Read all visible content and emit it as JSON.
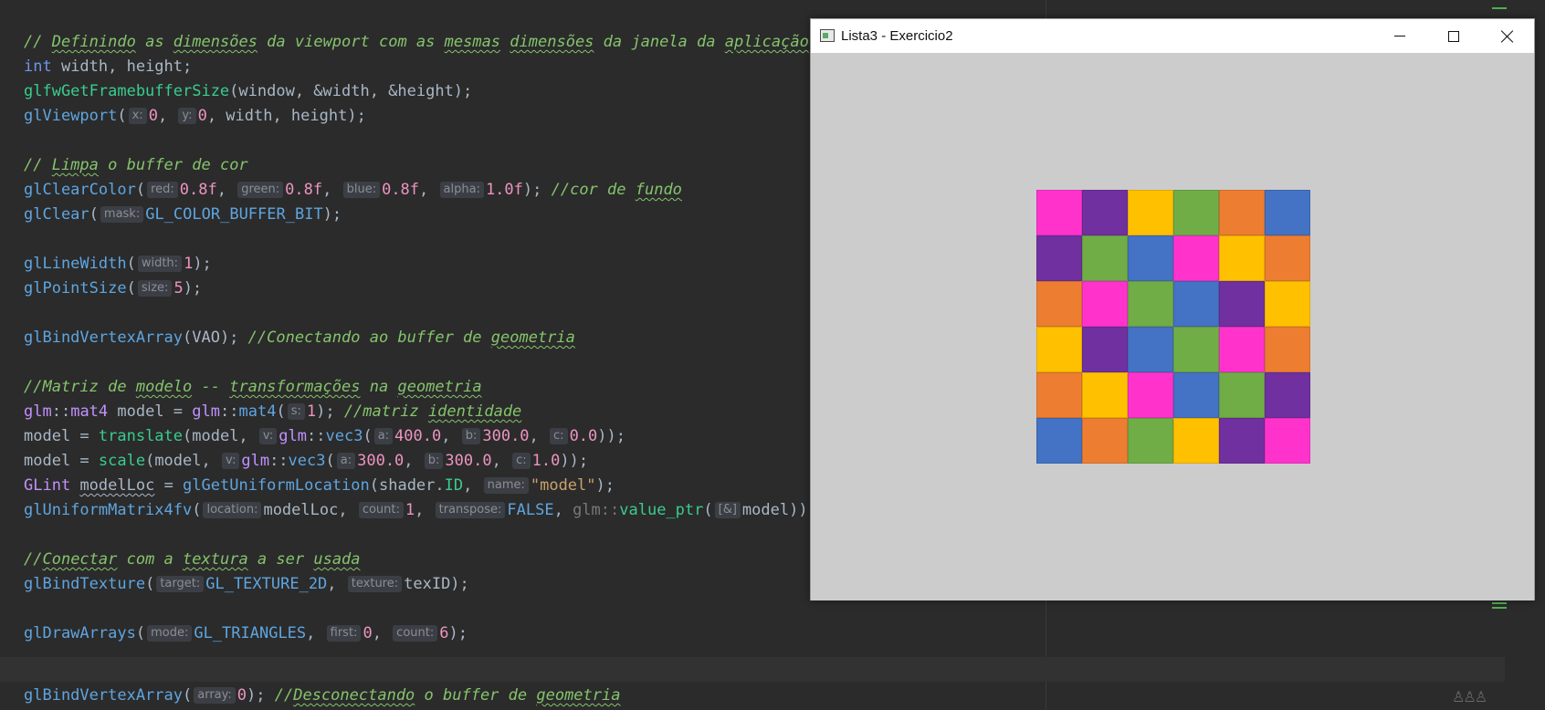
{
  "editor": {
    "lines": [
      {
        "y": 36
      },
      {
        "y": 63
      }
    ],
    "hints": {
      "x": "x:",
      "y": "y:",
      "red": "red:",
      "green": "green:",
      "blue": "blue:",
      "alpha": "alpha:",
      "mask": "mask:",
      "width": "width:",
      "size": "size:",
      "s": "s:",
      "v": "v:",
      "a": "a:",
      "b": "b:",
      "c": "c:",
      "name": "name:",
      "location": "location:",
      "count": "count:",
      "transpose": "transpose:",
      "ref": "[&]",
      "target": "target:",
      "texture": "texture:",
      "mode": "mode:",
      "first": "first:",
      "array": "array:"
    }
  },
  "window": {
    "title": "Lista3 - Exercicio2",
    "grid_colors": [
      [
        "#ff33cc",
        "#7030a0",
        "#ffc000",
        "#70ad47",
        "#ed7d31",
        "#4472c4"
      ],
      [
        "#7030a0",
        "#70ad47",
        "#4472c4",
        "#ff33cc",
        "#ffc000",
        "#ed7d31"
      ],
      [
        "#ed7d31",
        "#ff33cc",
        "#70ad47",
        "#4472c4",
        "#7030a0",
        "#ffc000"
      ],
      [
        "#ffc000",
        "#7030a0",
        "#4472c4",
        "#70ad47",
        "#ff33cc",
        "#ed7d31"
      ],
      [
        "#ed7d31",
        "#ffc000",
        "#ff33cc",
        "#4472c4",
        "#70ad47",
        "#7030a0"
      ],
      [
        "#4472c4",
        "#ed7d31",
        "#70ad47",
        "#ffc000",
        "#7030a0",
        "#ff33cc"
      ]
    ]
  },
  "icons": {
    "app": "app-icon",
    "minimize": "minimize-icon",
    "maximize": "maximize-icon",
    "close": "close-icon"
  }
}
